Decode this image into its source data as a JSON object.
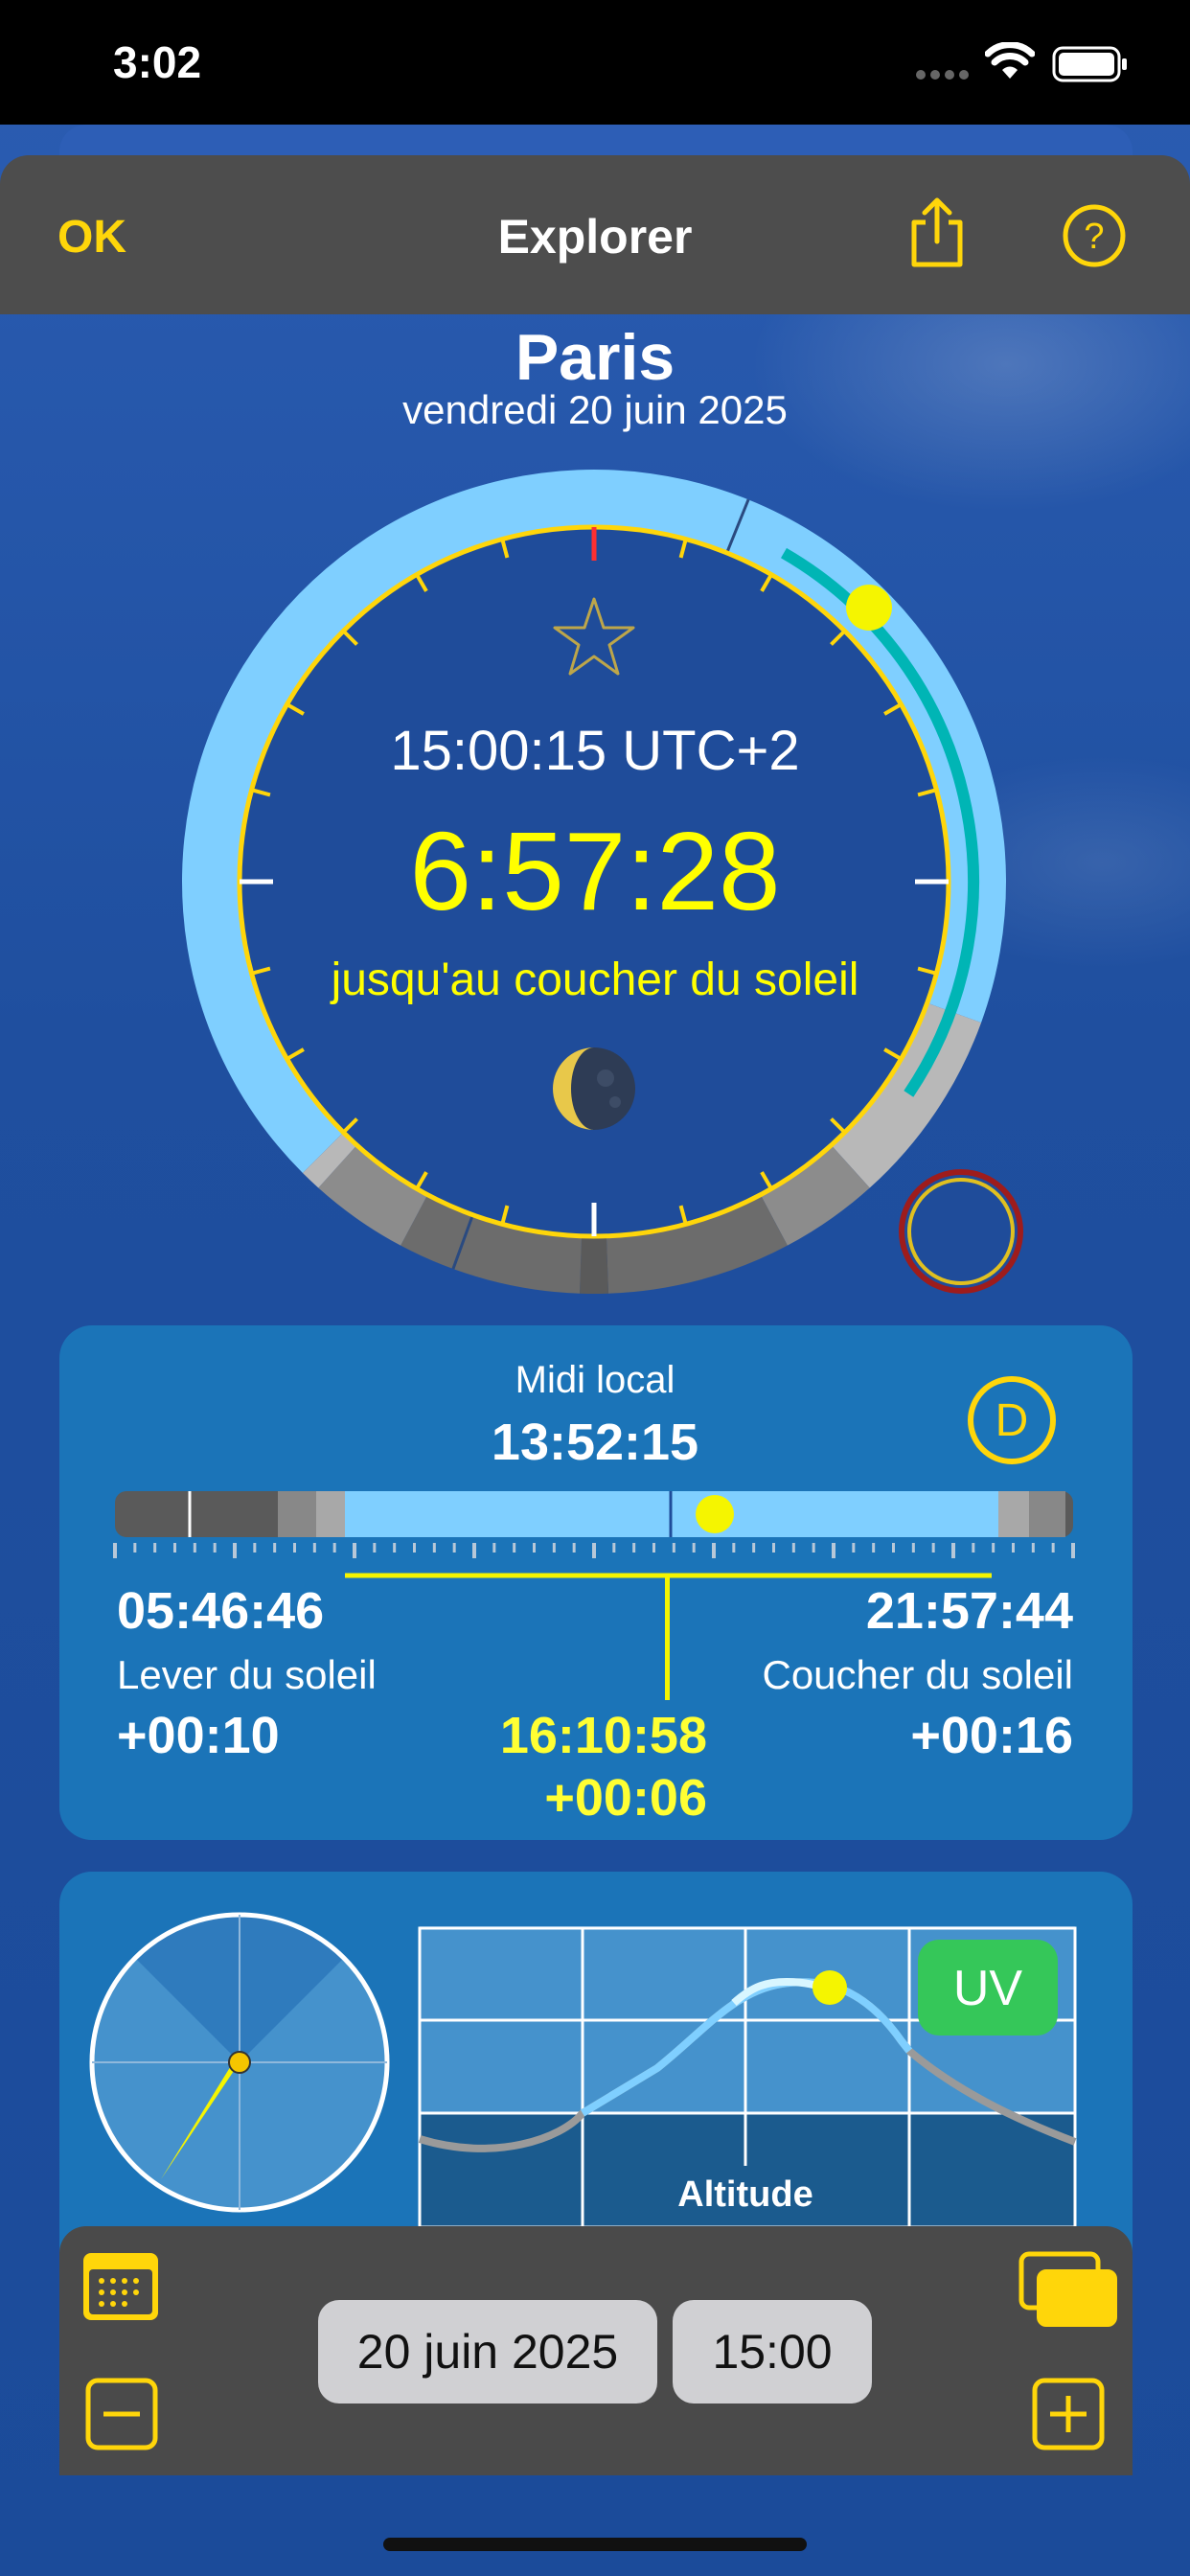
{
  "status_bar": {
    "time": "3:02"
  },
  "nav": {
    "ok_label": "OK",
    "title": "Explorer"
  },
  "header": {
    "city": "Paris",
    "date": "vendredi 20 juin 2025"
  },
  "dial": {
    "utc_time": "15:00:15 UTC+2",
    "countdown": "6:57:28",
    "countdown_caption": "jusqu'au coucher du soleil"
  },
  "day_card": {
    "noon_label": "Midi local",
    "noon_time": "13:52:15",
    "mode_badge": "D",
    "sunrise_time": "05:46:46",
    "sunrise_label": "Lever du soleil",
    "sunrise_delta": "+00:10",
    "sunset_time": "21:57:44",
    "sunset_label": "Coucher du soleil",
    "sunset_delta": "+00:16",
    "day_length": "16:10:58",
    "day_length_delta": "+00:06"
  },
  "sun_card": {
    "uv_badge": "UV",
    "altitude_label": "Altitude"
  },
  "toolbar": {
    "date_value": "20 juin 2025",
    "time_value": "15:00"
  },
  "colors": {
    "accent": "#ffd60a",
    "sky_day": "#7fcfff",
    "twilight": "#9a9a9a",
    "night": "#5a5a5a",
    "sun": "#f5f500",
    "uv": "#35c759"
  },
  "icons": [
    "share-icon",
    "help-icon",
    "star-icon",
    "moon-icon",
    "calendar-icon",
    "minus-icon",
    "plus-icon",
    "windows-icon",
    "signal-icon",
    "wifi-icon",
    "battery-icon"
  ]
}
